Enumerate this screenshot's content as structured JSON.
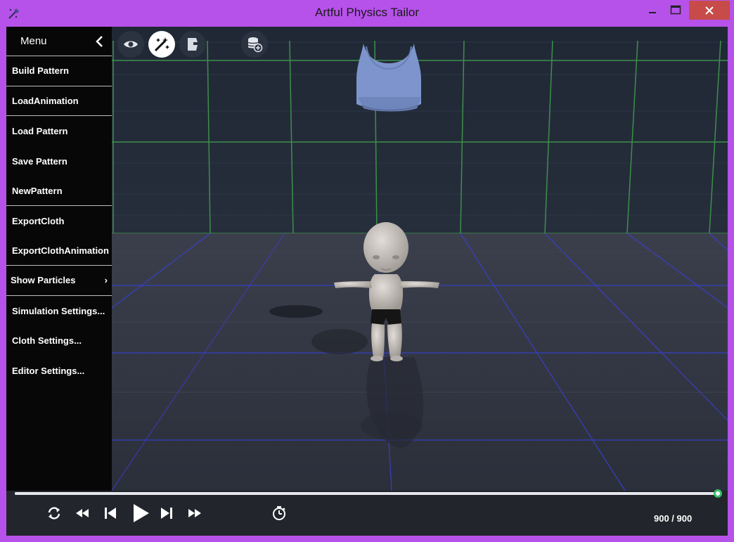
{
  "window": {
    "title": "Artful Physics Tailor",
    "icon": "app-icon",
    "controls": [
      "minimize-icon",
      "maximize-icon",
      "close-icon"
    ],
    "frame_color": "#b652ea",
    "close_color": "#c74b48"
  },
  "menu": {
    "title": "Menu",
    "collapse_icon": "chevron-left-icon",
    "items": [
      {
        "label": "Build Pattern"
      },
      {
        "label": "LoadAnimation"
      },
      {
        "label": "Load Pattern"
      },
      {
        "label": "Save Pattern"
      },
      {
        "label": "NewPattern"
      },
      {
        "label": "ExportCloth"
      },
      {
        "label": "ExportClothAnimation"
      },
      {
        "label": "Show Particles",
        "submenu": true
      },
      {
        "label": "Simulation Settings..."
      },
      {
        "label": "Cloth Settings..."
      },
      {
        "label": "Editor Settings..."
      }
    ]
  },
  "toolbar": {
    "buttons": [
      {
        "icon": "eye-icon",
        "active": false
      },
      {
        "icon": "magic-wand-icon",
        "active": true
      },
      {
        "icon": "garment-icon",
        "active": false
      },
      {
        "icon": "database-add-icon",
        "active": false
      }
    ]
  },
  "timeline": {
    "progress": 1.0,
    "controls": [
      "loop-icon",
      "rewind-icon",
      "skip-back-icon",
      "play-icon",
      "skip-forward-icon",
      "fast-forward-icon",
      "timer-icon"
    ],
    "frame_counter": "900 / 900",
    "accent": "#3bbf6a"
  },
  "scene": {
    "grid_wall_color": "#3e8f4a",
    "grid_floor_color": "#3a3fd0",
    "garment_color": "#7d95cc",
    "avatar_color": "#c9c4c0"
  }
}
